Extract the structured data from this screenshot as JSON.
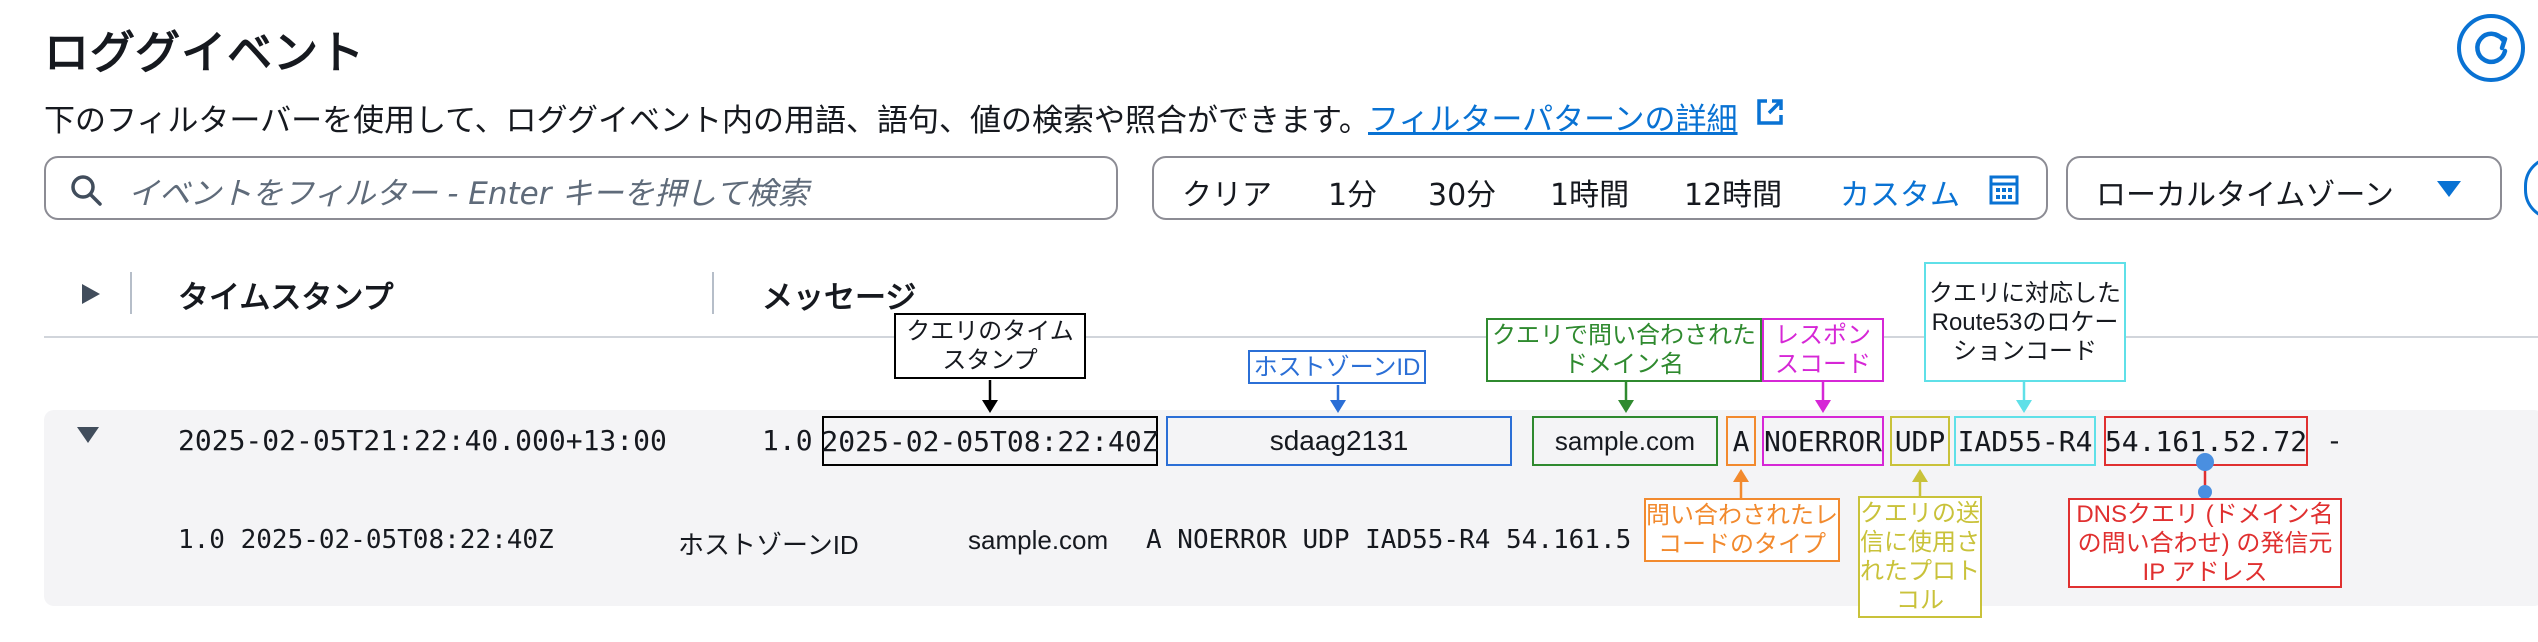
{
  "page": {
    "title": "ロググイベント",
    "description": "下のフィルターバーを使用して、ロググイベント内の用語、語句、値の検索や照合ができます。",
    "detail_link": "フィルターパターンの詳細"
  },
  "search": {
    "placeholder": "イベントをフィルター - Enter キーを押して検索"
  },
  "time_range": {
    "items": [
      "クリア",
      "1分",
      "30分",
      "1時間",
      "12時間",
      "カスタム"
    ]
  },
  "timezone": {
    "label": "ローカルタイムゾーン"
  },
  "table": {
    "headers": [
      "タイムスタンプ",
      "メッセージ"
    ]
  },
  "event": {
    "timestamp": "2025-02-05T21:22:40.000+13:00",
    "version": "1.0",
    "fields": {
      "query_timestamp": "2025-02-05T08:22:40Z",
      "hosted_zone_id": "sdaag2131",
      "query_name": "sample.com",
      "query_type": "A",
      "response_code": "NOERROR",
      "protocol": "UDP",
      "edge_location": "IAD55-R4",
      "resolver_ip": "54.161.52.72",
      "trailing": "-"
    },
    "expanded": {
      "prefix": "1.0 2025-02-05T08:22:40Z",
      "hosted_zone_label": "ホストゾーンID",
      "query_name": "sample.com",
      "rest": "A NOERROR UDP IAD55-R4 54.161.5"
    }
  },
  "annotations": {
    "query_timestamp": "クエリのタイムスタンプ",
    "hosted_zone_id": "ホストゾーンID",
    "query_name": "クエリで問い合わされたドメイン名",
    "response_code": "レスポンスコード",
    "edge_location": "クエリに対応したRoute53のロケーションコード",
    "query_type": "問い合わされたレコードのタイプ",
    "protocol": "クエリの送信に使用されたプロトコル",
    "resolver_ip": "DNSクエリ (ドメイン名の問い合わせ) の発信元IP アドレス"
  },
  "colors": {
    "accent": "#0972d3",
    "timestamp": "#000000",
    "hosted_zone": "#2b6fd6",
    "query_name": "#2f8a2f",
    "query_type": "#f28a2e",
    "response_code": "#d627d6",
    "protocol": "#c9c23a",
    "edge_location": "#5fe0e8",
    "resolver_ip": "#e03030"
  }
}
